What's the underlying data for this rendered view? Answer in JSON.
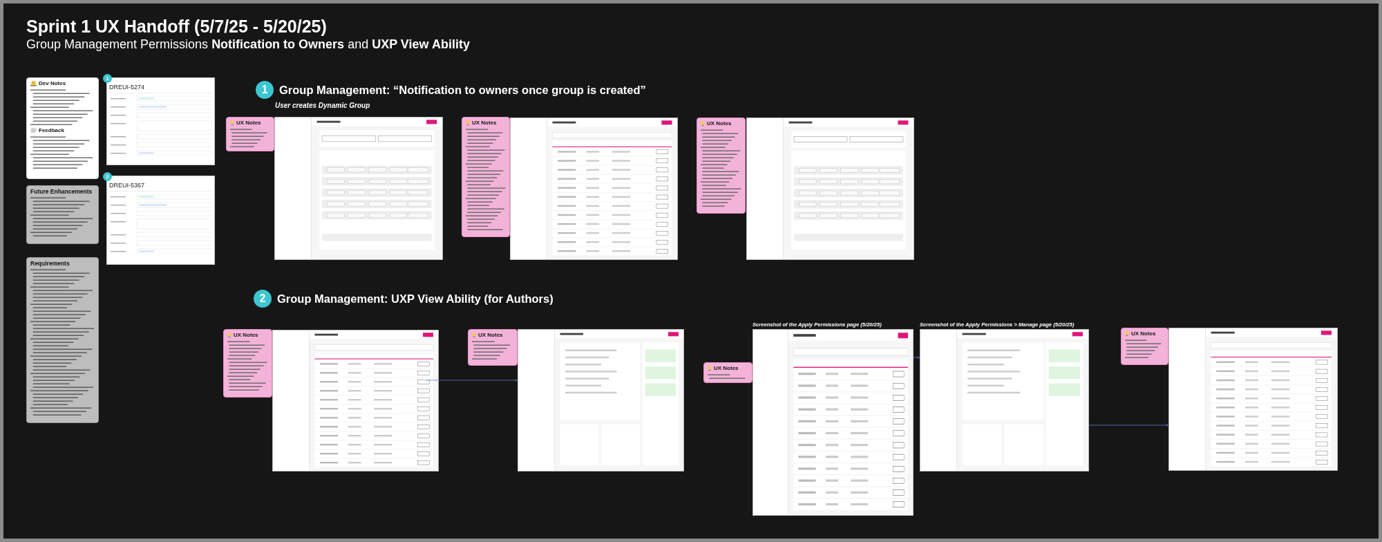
{
  "board": {
    "title": "Sprint 1 UX Handoff (5/7/25 - 5/20/25)",
    "subtitle": "Group Management Permissions **Notification to Owners** and **UXP View Ability**"
  },
  "dev_notes": {
    "title": "Dev Notes",
    "feedback_title": "Feedback"
  },
  "future_enhancements": {
    "title": "Future Enhancements"
  },
  "requirements": {
    "title": "Requirements"
  },
  "jira_cards": [
    {
      "badge": "1",
      "id": "DREUI-5274"
    },
    {
      "badge": "2",
      "id": "DREUI-5367"
    }
  ],
  "sections": [
    {
      "badge": "1",
      "title": "Group Management: “Notification to owners once group is created”",
      "subtitle": "User creates Dynamic Group",
      "notes": [
        {
          "title": "UX Notes"
        },
        {
          "title": "UX Notes"
        },
        {
          "title": "UX Notes"
        }
      ],
      "screens": [
        {
          "kind": "form"
        },
        {
          "kind": "table"
        },
        {
          "kind": "form"
        }
      ]
    },
    {
      "badge": "2",
      "title": "Group Management: UXP View Ability (for Authors)",
      "notes": [
        {
          "title": "UX Notes"
        },
        {
          "title": "UX Notes"
        },
        {
          "title": "UX Notes"
        },
        {
          "title": "UX Notes"
        }
      ],
      "screens": [
        {
          "kind": "table"
        },
        {
          "kind": "detail"
        },
        {
          "kind": "table",
          "caption": "Screenshot of the Apply Permissions page (5/20/25)"
        },
        {
          "kind": "detail",
          "caption": "Screenshot of the Apply Permissions > Manage page (5/20/25)"
        },
        {
          "kind": "table"
        }
      ]
    }
  ]
}
